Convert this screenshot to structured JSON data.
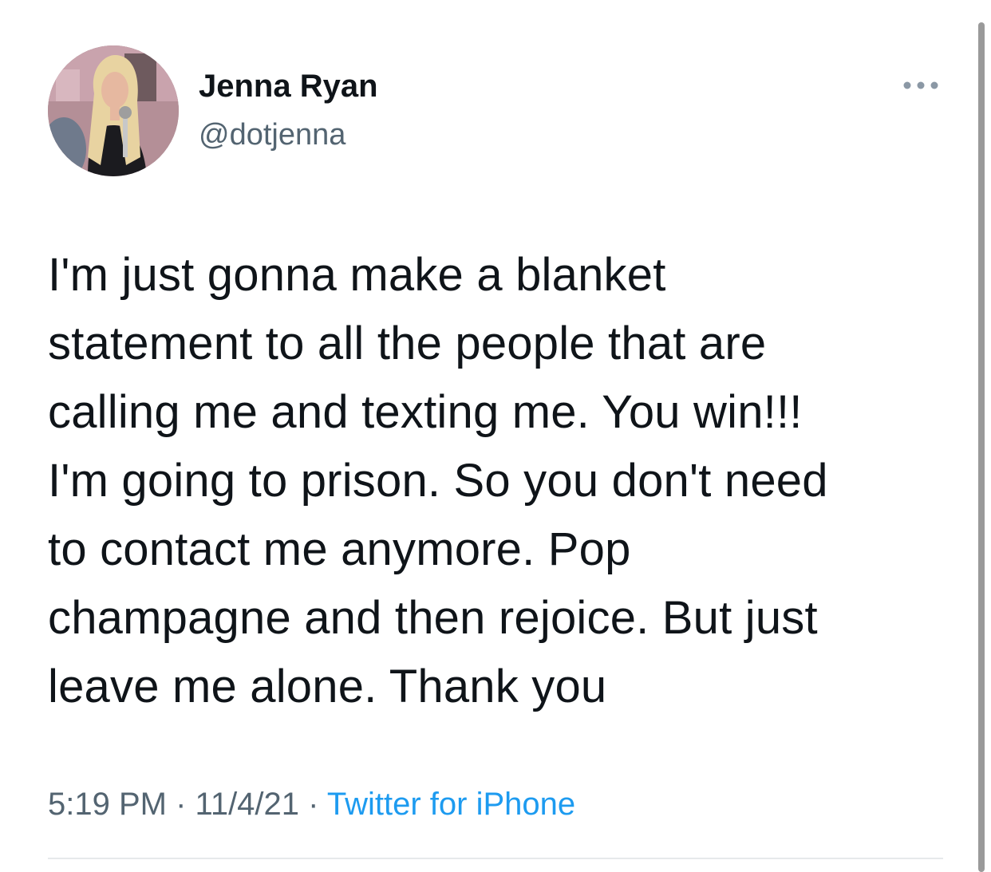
{
  "tweet": {
    "author_name": "Jenna Ryan",
    "author_handle": "@dotjenna",
    "text": "I'm just gonna make a blanket\nstatement to all the people that are\ncalling me and texting me. You win!!!\nI'm going to prison. So you don't need\nto contact me anymore. Pop\nchampagne and then rejoice. But just\nleave me alone. Thank you",
    "time": "5:19 PM",
    "date": "11/4/21",
    "separator": "·",
    "source": "Twitter for iPhone"
  },
  "icons": {
    "more": "more-horizontal-icon",
    "avatar": "profile-photo"
  },
  "colors": {
    "text": "#0f1419",
    "secondary": "#536471",
    "link": "#1d9bf0",
    "divider": "#e6e9eb"
  }
}
